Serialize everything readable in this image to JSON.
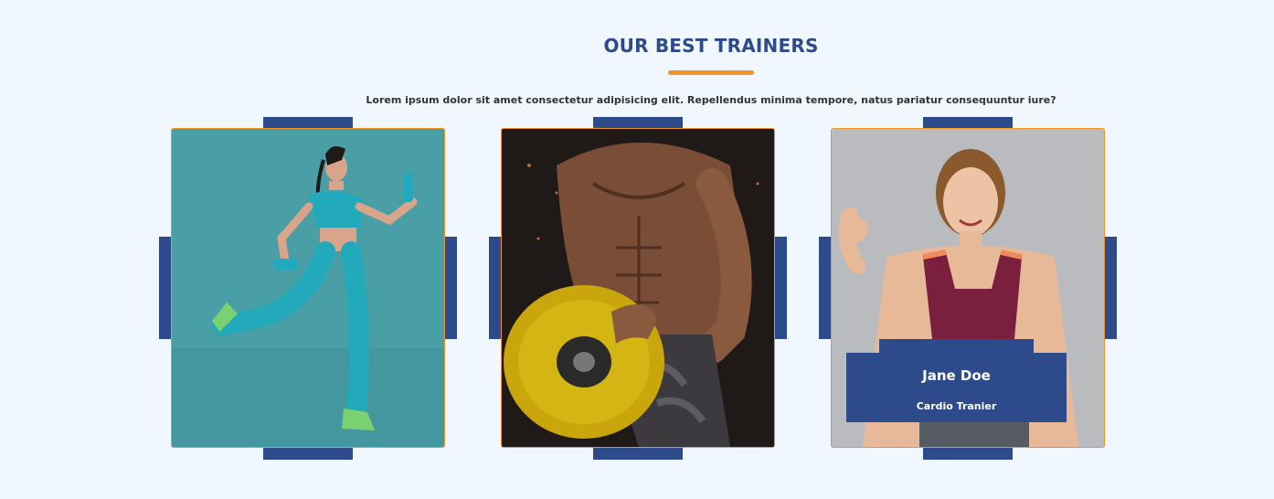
{
  "section": {
    "title": "OUR BEST TRAINERS",
    "description": "Lorem ipsum dolor sit amet consectetur adipisicing elit. Repellendus minima tempore, natus pariatur consequuntur iure?"
  },
  "trainers": [
    {
      "photo_subject": "woman running with dumbbells on teal background"
    },
    {
      "photo_subject": "muscular man holding yellow weight plate"
    },
    {
      "photo_subject": "smiling woman making ok gesture",
      "name": "Jane Doe",
      "role": "Cardio Tranier"
    }
  ],
  "colors": {
    "background": "#f0f7ff",
    "primary": "#2d4a8a",
    "accent": "#f29422"
  }
}
